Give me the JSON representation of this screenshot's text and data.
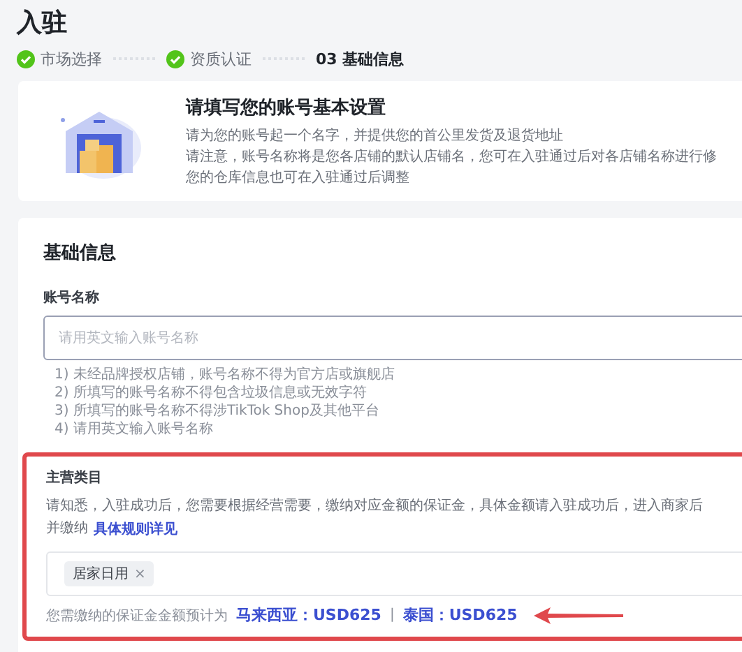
{
  "page": {
    "title": "入驻"
  },
  "steps": [
    {
      "label": "市场选择",
      "done": true,
      "selected": false
    },
    {
      "label": "资质认证",
      "done": true,
      "selected": false
    },
    {
      "number": "03",
      "label": "基础信息",
      "done": false,
      "selected": true
    }
  ],
  "intro": {
    "title": "请填写您的账号基本设置",
    "lines": [
      "请为您的账号起一个名字，并提供您的首公里发货及退货地址",
      "请注意，账号名称将是您各店铺的默认店铺名，您可在入驻通过后对各店铺名称进行修",
      "您的仓库信息也可在入驻通过后调整"
    ]
  },
  "form": {
    "title": "基础信息",
    "account_name": {
      "label": "账号名称",
      "placeholder": "请用英文输入账号名称",
      "hints": [
        "1) 未经品牌授权店铺，账号名称不得为官方店或旗舰店",
        "2) 所填写的账号名称不得包含垃圾信息或无效字符",
        "3) 所填写的账号名称不得涉TikTok Shop及其他平台",
        "4) 请用英文输入账号名称"
      ]
    },
    "main_category": {
      "label": "主营类目",
      "highlighted": true,
      "notice": "请知悉，入驻成功后，您需要根据经营需要，缴纳对应金额的保证金，具体金额请入驻成功后，进入商家后",
      "notice_prefix": "并缴纳",
      "rules_link": "具体规则详见",
      "tags": [
        {
          "label": "居家日用",
          "remove": "×"
        }
      ],
      "deposit_prefix": "您需缴纳的保证金金额预计为",
      "deposit": [
        "马来西亚：USD625",
        "泰国：USD625"
      ],
      "separator": "|",
      "pointer_arrow": true
    }
  }
}
